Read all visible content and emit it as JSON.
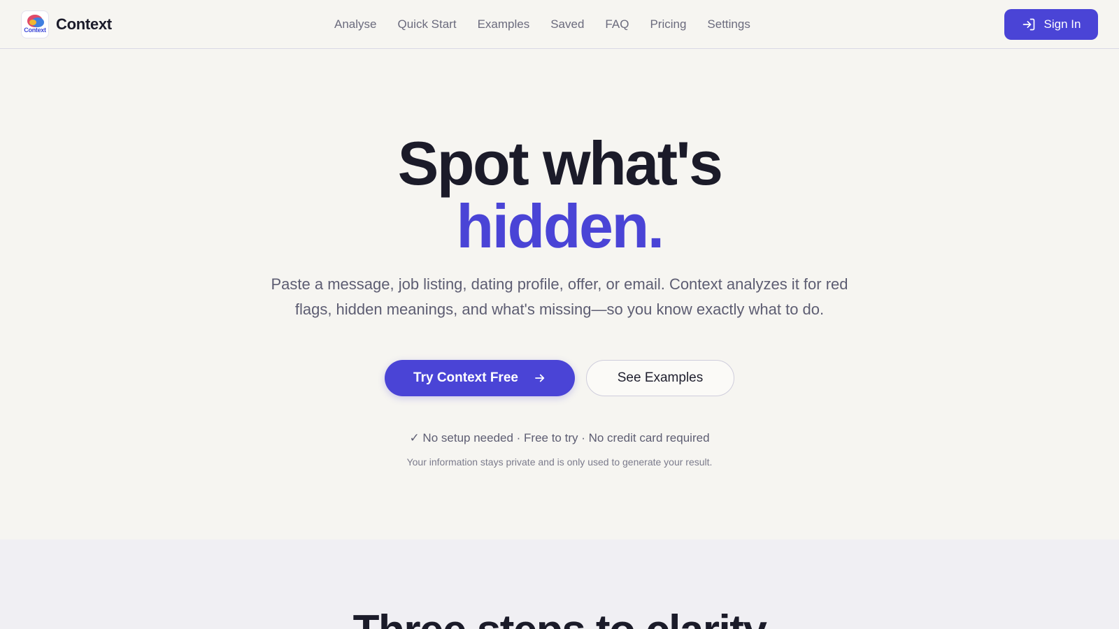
{
  "brand": {
    "name": "Context",
    "logo_text": "Context"
  },
  "nav": {
    "items": [
      {
        "label": "Analyse"
      },
      {
        "label": "Quick Start"
      },
      {
        "label": "Examples"
      },
      {
        "label": "Saved"
      },
      {
        "label": "FAQ"
      },
      {
        "label": "Pricing"
      },
      {
        "label": "Settings"
      }
    ],
    "signin_label": "Sign In"
  },
  "hero": {
    "headline_line1": "Spot what's",
    "headline_line2": "hidden.",
    "subtitle": "Paste a message, job listing, dating profile, offer, or email. Context analyzes it for red flags, hidden meanings, and what's missing—so you know exactly what to do.",
    "primary_cta": "Try Context Free",
    "secondary_cta": "See Examples",
    "assurance": "✓ No setup needed · Free to try · No credit card required",
    "privacy": "Your information stays private and is only used to generate your result."
  },
  "steps": {
    "title": "Three steps to clarity"
  },
  "colors": {
    "accent": "#4a44d6",
    "background": "#f6f5f1",
    "section_alt": "#f0eff3",
    "text_dark": "#1b1b29",
    "text_muted": "#5d5d72"
  },
  "icons": {
    "signin": "sign-in-icon",
    "cta_arrow": "arrow-right-icon"
  }
}
